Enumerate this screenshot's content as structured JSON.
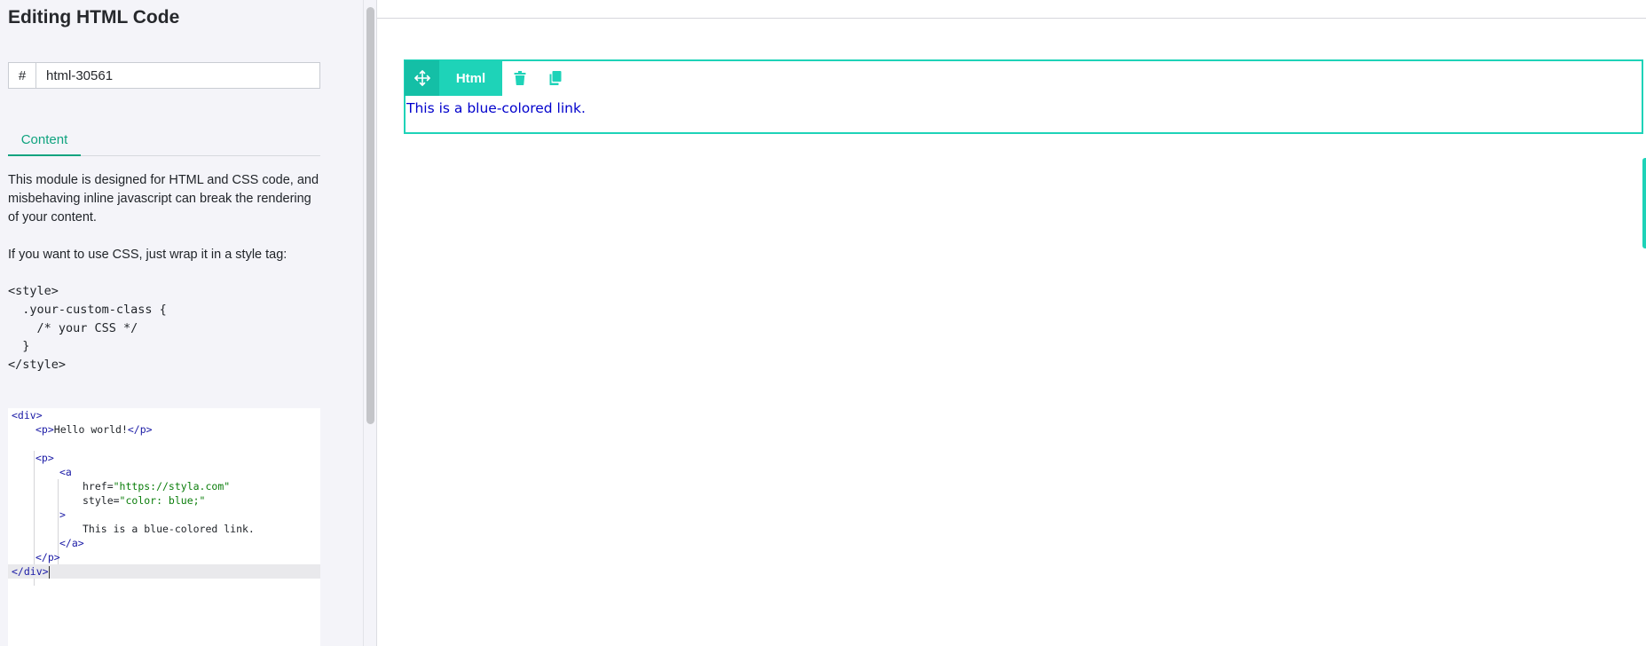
{
  "panel": {
    "title": "Editing HTML Code",
    "id_field": {
      "prefix": "#",
      "value": "html-30561"
    },
    "tabs": [
      {
        "label": "Content"
      }
    ],
    "help": {
      "paragraph1": "This module is designed for HTML and CSS code, and misbehaving inline javascript can break the rendering of your content.",
      "paragraph2": "If you want to use CSS, just wrap it in a style tag:",
      "snippet": [
        "<style>",
        "  .your-custom-class {",
        "    /* your CSS */",
        "  }",
        "</style>"
      ]
    }
  },
  "editor": {
    "lines": [
      {
        "pre": "<div>"
      },
      {
        "tag_open": "<p>",
        "text": "Hello world!",
        "tag_close": "</p>"
      },
      {
        "empty": ""
      },
      {
        "pre": "<p>"
      },
      {
        "pre": "<a"
      },
      {
        "attr": "href=",
        "str": "\"https://styla.com\""
      },
      {
        "attr": "style=",
        "str": "\"color: blue;\""
      },
      {
        "pre": ">"
      },
      {
        "text": "This is a blue-colored link."
      },
      {
        "pre": "</a>"
      },
      {
        "pre": "</p>"
      },
      {
        "pre": "</div>"
      }
    ]
  },
  "canvas": {
    "module": {
      "type_label": "Html",
      "link_text": "This is a blue-colored link.",
      "link_color": "#0000cc"
    },
    "accent": "#1ed3b8"
  },
  "colors": {
    "accent_green": "#10a37f",
    "module_teal": "#1ed3b8"
  },
  "icons": [
    "move-icon",
    "trash-icon",
    "copy-icon"
  ]
}
